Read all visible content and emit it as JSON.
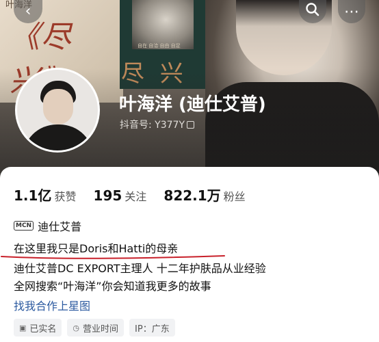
{
  "header": {
    "book_left_title": "《尽 兴》",
    "book_left_top": "叶海洋",
    "book_center_title": "尽 兴",
    "book_center_small": "自在 自洽 自由 自足"
  },
  "nav": {
    "back_icon": "‹",
    "search_icon": "⌕",
    "more_icon": "⋯"
  },
  "profile": {
    "name": "叶海洋 (迪仕艾普)",
    "handle": "抖音号: Y377Y"
  },
  "stats": [
    {
      "value": "1.1亿",
      "label": "获赞"
    },
    {
      "value": "195",
      "label": "关注"
    },
    {
      "value": "822.1万",
      "label": "粉丝"
    }
  ],
  "mcn": {
    "icon": "MCN",
    "label": "迪仕艾普"
  },
  "bio": {
    "line1": "在这里我只是Doris和Hatti的母亲",
    "line2": "迪仕艾普DC EXPORT主理人 十二年护肤品从业经验",
    "line3": "全网搜索“叶海洋”你会知道我更多的故事"
  },
  "link": "找我合作上星图",
  "tags": [
    {
      "icon": "▣",
      "label": "已实名"
    },
    {
      "icon": "◷",
      "label": "营业时间"
    },
    {
      "icon": "",
      "label": "IP：广东"
    }
  ],
  "colors": {
    "link": "#2c5aa0",
    "underline": "#c8202a"
  }
}
